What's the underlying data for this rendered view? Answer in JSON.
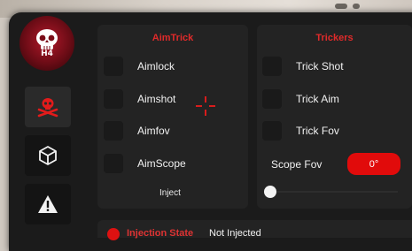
{
  "brand": {
    "logo_text": "H4"
  },
  "sidebar": {
    "items": [
      {
        "icon": "skull-crossbones-icon",
        "active": true
      },
      {
        "icon": "cube-icon",
        "active": false
      },
      {
        "icon": "warning-icon",
        "active": false
      }
    ]
  },
  "aimtrick": {
    "title": "AimTrick",
    "options": [
      "Aimlock",
      "Aimshot",
      "Aimfov",
      "AimScope"
    ],
    "inject_label": "Inject"
  },
  "trickers": {
    "title": "Trickers",
    "options": [
      "Trick Shot",
      "Trick Aim",
      "Trick Fov"
    ],
    "scope_fov_label": "Scope Fov",
    "scope_fov_value": "0°",
    "slider_level": 0
  },
  "status": {
    "label": "Injection State",
    "value": "Not Injected"
  },
  "colors": {
    "accent": "#e10b0b",
    "panel": "#1b1b1b",
    "card": "#232323"
  }
}
